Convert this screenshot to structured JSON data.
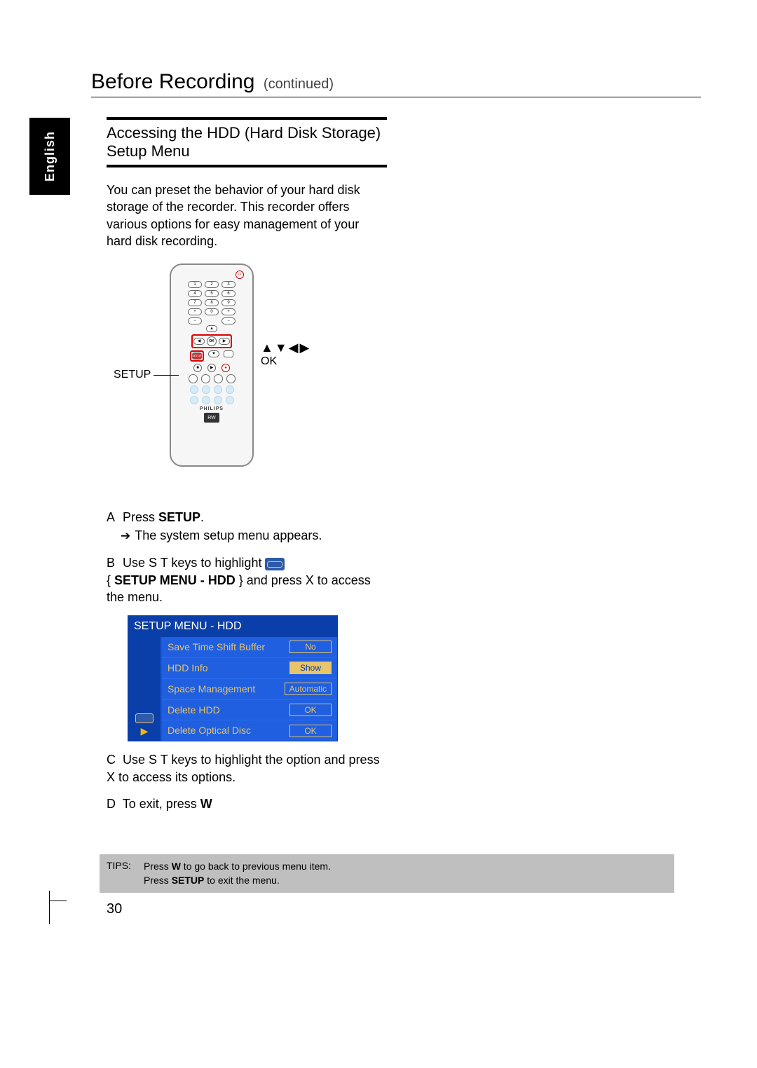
{
  "language_tab": "English",
  "header": {
    "title": "Before Recording",
    "subtitle": "(continued)"
  },
  "section_title": "Accessing the  HDD (Hard Disk Storage) Setup Menu",
  "intro": "You can preset the behavior of your hard disk storage of the recorder. This recorder offers various options for easy management of your hard disk recording.",
  "remote": {
    "label_left": "SETUP",
    "label_right_arrows": "▲▼◀▶",
    "label_right_ok": "OK",
    "brand": "PHILIPS",
    "rw": "RW"
  },
  "steps": {
    "A": {
      "label": "A",
      "line1_pre": "Press ",
      "line1_bold": "SETUP",
      "line1_post": ".",
      "sub": "The system setup menu appears."
    },
    "B": {
      "label": "B",
      "line1": "Use  S T  keys to highlight",
      "line2_pre": "{ ",
      "line2_bold": "SETUP MENU - HDD",
      "line2_post": " } and press X to access the menu."
    },
    "C": {
      "label": "C",
      "text": "Use  S T  keys to highlight the option and press  X to access its options."
    },
    "D": {
      "label": "D",
      "text_pre": "To exit, press ",
      "text_bold": "W"
    }
  },
  "menu": {
    "title": "SETUP MENU - HDD",
    "rows": [
      {
        "label": "Save Time Shift Buffer",
        "value": "No",
        "selected": false
      },
      {
        "label": "HDD Info",
        "value": "Show",
        "selected": true
      },
      {
        "label": "Space Management",
        "value": "Automatic",
        "selected": false
      },
      {
        "label": "Delete HDD",
        "value": "OK",
        "selected": false
      },
      {
        "label": "Delete Optical Disc",
        "value": "OK",
        "selected": false
      }
    ]
  },
  "tips": {
    "label": "TIPS:",
    "line1_pre": "Press ",
    "line1_bold": "W",
    "line1_post": " to go back to previous menu item.",
    "line2_pre": "Press ",
    "line2_bold": "SETUP",
    "line2_post": " to exit the menu."
  },
  "page_number": "30"
}
